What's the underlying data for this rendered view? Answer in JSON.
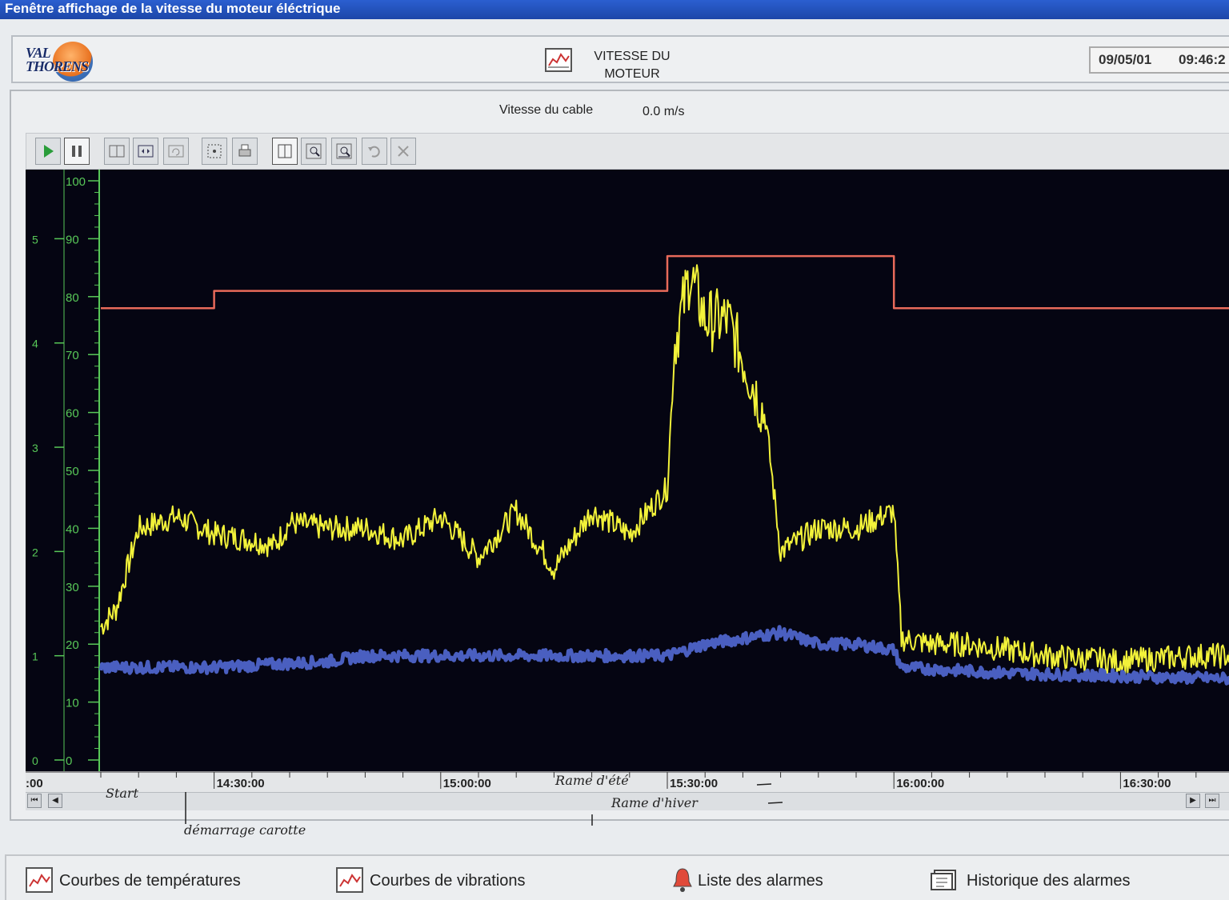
{
  "window": {
    "title": "Fenêtre affichage de la vitesse du moteur éléctrique"
  },
  "header": {
    "logo_text_line1": "VAL",
    "logo_text_line2": "THORENS",
    "title_line1": "VITESSE DU",
    "title_line2": "MOTEUR",
    "date": "09/05/01",
    "time": "09:46:2"
  },
  "status": {
    "speed_label": "Vitesse du cable",
    "speed_value": "0.0 m/s"
  },
  "toolbar": {
    "buttons": [
      "play-icon",
      "pause-icon",
      "zoom-out-horizontal-icon",
      "zoom-in-horizontal-icon",
      "reset-zoom-icon",
      "select-area-icon",
      "print-icon",
      "cursor-icon",
      "zoom-region-icon",
      "zoom-time-icon",
      "undo-zoom-icon",
      "close-icon"
    ]
  },
  "chart_data": {
    "type": "line",
    "y_scale_inner": {
      "range": [
        0,
        100
      ],
      "ticks": [
        "0",
        "10",
        "20",
        "30",
        "40",
        "50",
        "60",
        "70",
        "80",
        "90",
        "100"
      ]
    },
    "y_scale_outer": {
      "ticks": [
        "0",
        "1",
        "2",
        "3",
        "4",
        "5"
      ]
    },
    "x_axis": {
      "visible_start_label": ":00",
      "tick_labels": [
        "14:30:00",
        "15:00:00",
        "15:30:00",
        "16:00:00",
        "16:30:00"
      ]
    },
    "series": [
      {
        "color": "#e86a5a",
        "x": [
          "14:15",
          "14:30",
          "14:30",
          "15:30",
          "15:30",
          "16:00",
          "16:00",
          "16:45"
        ],
        "values": [
          78,
          78,
          81,
          81,
          87,
          87,
          78,
          78
        ]
      },
      {
        "color": "#f2f23a",
        "x": [
          "14:15",
          "14:17",
          "14:20",
          "14:25",
          "14:30",
          "14:35",
          "14:38",
          "14:40",
          "14:45",
          "14:50",
          "14:55",
          "15:00",
          "15:05",
          "15:10",
          "15:15",
          "15:20",
          "15:25",
          "15:30",
          "15:31",
          "15:33",
          "15:35",
          "15:38",
          "15:41",
          "15:43",
          "15:45",
          "15:50",
          "15:55",
          "16:00",
          "16:01",
          "16:05",
          "16:10",
          "16:15",
          "16:20",
          "16:30",
          "16:40",
          "16:45"
        ],
        "values": [
          23,
          26,
          40,
          42,
          39,
          38,
          37,
          41,
          40,
          40,
          38,
          42,
          35,
          43,
          33,
          43,
          39,
          47,
          72,
          84,
          76,
          76,
          66,
          59,
          36,
          40,
          40,
          43,
          21,
          20,
          20,
          19,
          18,
          17,
          18,
          18
        ]
      },
      {
        "color": "#4a5fc0",
        "x": [
          "14:15",
          "14:30",
          "14:45",
          "14:50",
          "15:00",
          "15:15",
          "15:30",
          "15:35",
          "15:45",
          "15:50",
          "15:55",
          "16:00",
          "16:01",
          "16:15",
          "16:45"
        ],
        "values": [
          16,
          16,
          17,
          18,
          18,
          18,
          18,
          20,
          22,
          20,
          20,
          19,
          16,
          15,
          14
        ]
      }
    ],
    "annotations": [
      "Start",
      "Rame d'été",
      "Rame d'hiver",
      "démarrage carotte"
    ]
  },
  "scroll": {
    "first": "⏮",
    "prev": "◀",
    "next": "▶",
    "last": "⏭"
  },
  "nav": [
    {
      "label": "Courbes de températures",
      "icon": "chart-icon"
    },
    {
      "label": "Courbes de vibrations",
      "icon": "chart-icon"
    },
    {
      "label": "Liste des alarmes",
      "icon": "bell-icon"
    },
    {
      "label": "Historique des alarmes",
      "icon": "history-icon"
    }
  ]
}
